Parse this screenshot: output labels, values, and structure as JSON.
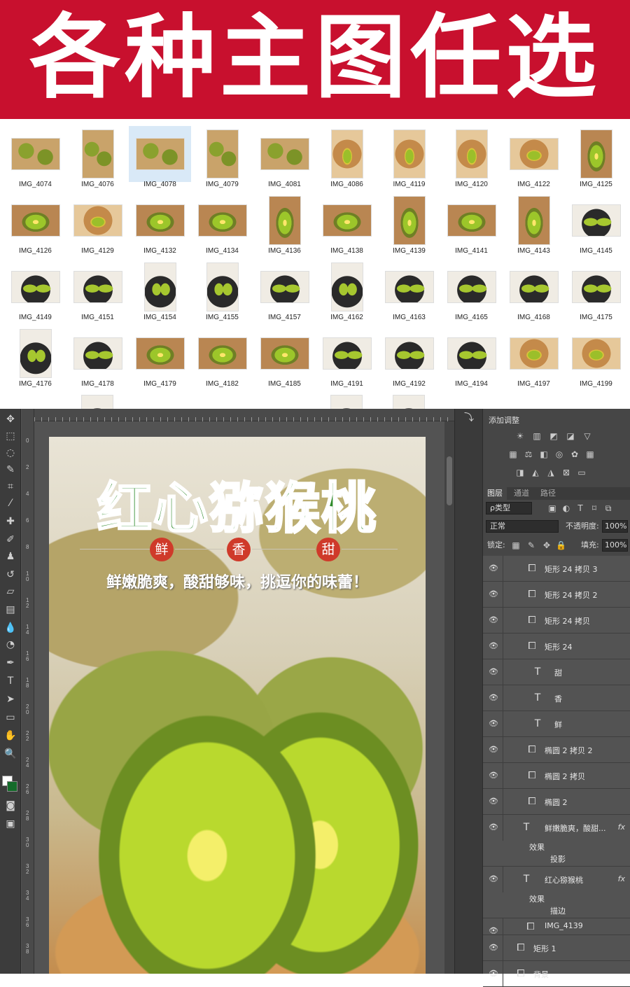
{
  "banner": {
    "text": "各种主图任选"
  },
  "thumbnails": [
    {
      "label": "IMG_4074",
      "kind": "k-box",
      "shape": "land"
    },
    {
      "label": "IMG_4076",
      "kind": "k-box",
      "shape": "port"
    },
    {
      "label": "IMG_4078",
      "kind": "k-box",
      "shape": "land",
      "selected": true
    },
    {
      "label": "IMG_4079",
      "kind": "k-box",
      "shape": "port"
    },
    {
      "label": "IMG_4081",
      "kind": "k-box",
      "shape": "land"
    },
    {
      "label": "IMG_4086",
      "kind": "k-wood",
      "shape": "port"
    },
    {
      "label": "IMG_4119",
      "kind": "k-wood",
      "shape": "port"
    },
    {
      "label": "IMG_4120",
      "kind": "k-wood",
      "shape": "port"
    },
    {
      "label": "IMG_4122",
      "kind": "k-wood",
      "shape": "land"
    },
    {
      "label": "IMG_4125",
      "kind": "k-half",
      "shape": "port"
    },
    {
      "label": "IMG_4126",
      "kind": "k-half",
      "shape": "land"
    },
    {
      "label": "IMG_4129",
      "kind": "k-wood",
      "shape": "land"
    },
    {
      "label": "IMG_4132",
      "kind": "k-half",
      "shape": "land"
    },
    {
      "label": "IMG_4134",
      "kind": "k-half",
      "shape": "land"
    },
    {
      "label": "IMG_4136",
      "kind": "k-half",
      "shape": "port"
    },
    {
      "label": "IMG_4138",
      "kind": "k-half",
      "shape": "land"
    },
    {
      "label": "IMG_4139",
      "kind": "k-half",
      "shape": "port"
    },
    {
      "label": "IMG_4141",
      "kind": "k-half",
      "shape": "land"
    },
    {
      "label": "IMG_4143",
      "kind": "k-half",
      "shape": "port"
    },
    {
      "label": "IMG_4145",
      "kind": "k-dark",
      "shape": "land"
    },
    {
      "label": "IMG_4149",
      "kind": "k-dark",
      "shape": "land"
    },
    {
      "label": "IMG_4151",
      "kind": "k-dark",
      "shape": "land"
    },
    {
      "label": "IMG_4154",
      "kind": "k-dark",
      "shape": "port"
    },
    {
      "label": "IMG_4155",
      "kind": "k-dark",
      "shape": "port"
    },
    {
      "label": "IMG_4157",
      "kind": "k-dark",
      "shape": "land"
    },
    {
      "label": "IMG_4162",
      "kind": "k-dark",
      "shape": "port"
    },
    {
      "label": "IMG_4163",
      "kind": "k-dark",
      "shape": "land"
    },
    {
      "label": "IMG_4165",
      "kind": "k-dark",
      "shape": "land"
    },
    {
      "label": "IMG_4168",
      "kind": "k-dark",
      "shape": "land"
    },
    {
      "label": "IMG_4175",
      "kind": "k-dark",
      "shape": "land"
    },
    {
      "label": "IMG_4176",
      "kind": "k-dark",
      "shape": "port"
    },
    {
      "label": "IMG_4178",
      "kind": "k-dark",
      "shape": "land"
    },
    {
      "label": "IMG_4179",
      "kind": "k-half",
      "shape": "land"
    },
    {
      "label": "IMG_4182",
      "kind": "k-half",
      "shape": "land"
    },
    {
      "label": "IMG_4185",
      "kind": "k-half",
      "shape": "land"
    },
    {
      "label": "IMG_4191",
      "kind": "k-dark",
      "shape": "land"
    },
    {
      "label": "IMG_4192",
      "kind": "k-dark",
      "shape": "land"
    },
    {
      "label": "IMG_4194",
      "kind": "k-dark",
      "shape": "land"
    },
    {
      "label": "IMG_4197",
      "kind": "k-wood",
      "shape": "land"
    },
    {
      "label": "IMG_4199",
      "kind": "k-wood",
      "shape": "land"
    }
  ],
  "ruler_v_labels": [
    "0",
    "2",
    "4",
    "6",
    "8",
    "10",
    "12",
    "14",
    "16",
    "18",
    "20",
    "22",
    "24",
    "26",
    "28",
    "30",
    "32",
    "34",
    "36",
    "38"
  ],
  "poster": {
    "title": "红心猕猴桃",
    "badges": [
      "鲜",
      "香",
      "甜"
    ],
    "subtitle": "鲜嫩脆爽，酸甜够味，挑逗你的味蕾！"
  },
  "panel": {
    "title": "添加调整",
    "tabs": [
      "图层",
      "通道",
      "路径"
    ],
    "filter_label": "ρ类型",
    "blend_mode": "正常",
    "opacity_label": "不透明度:",
    "opacity_value": "100%",
    "lock_label": "锁定:",
    "fill_label": "填充:",
    "fill_value": "100%"
  },
  "layers": [
    {
      "name": "矩形 24 拷贝 3",
      "icon": "shape"
    },
    {
      "name": "矩形 24 拷贝 2",
      "icon": "shape"
    },
    {
      "name": "矩形 24 拷贝",
      "icon": "shape"
    },
    {
      "name": "矩形 24",
      "icon": "shape"
    },
    {
      "name": "甜",
      "icon": "text"
    },
    {
      "name": "香",
      "icon": "text"
    },
    {
      "name": "鲜",
      "icon": "text"
    },
    {
      "name": "椭圆 2 拷贝 2",
      "icon": "shape"
    },
    {
      "name": "椭圆 2 拷贝",
      "icon": "shape"
    },
    {
      "name": "椭圆 2",
      "icon": "shape"
    }
  ],
  "fx_layers": [
    {
      "name": "鲜嫩脆爽，酸甜...",
      "fx": "fx",
      "effects_label": "效果",
      "effect": "投影"
    },
    {
      "name": "红心猕猴桃",
      "fx": "fx",
      "effects_label": "效果",
      "effect": "描边"
    }
  ],
  "bottom_layers": [
    {
      "name": "IMG_4139"
    },
    {
      "name": "矩形 1"
    },
    {
      "name": "背景"
    }
  ]
}
